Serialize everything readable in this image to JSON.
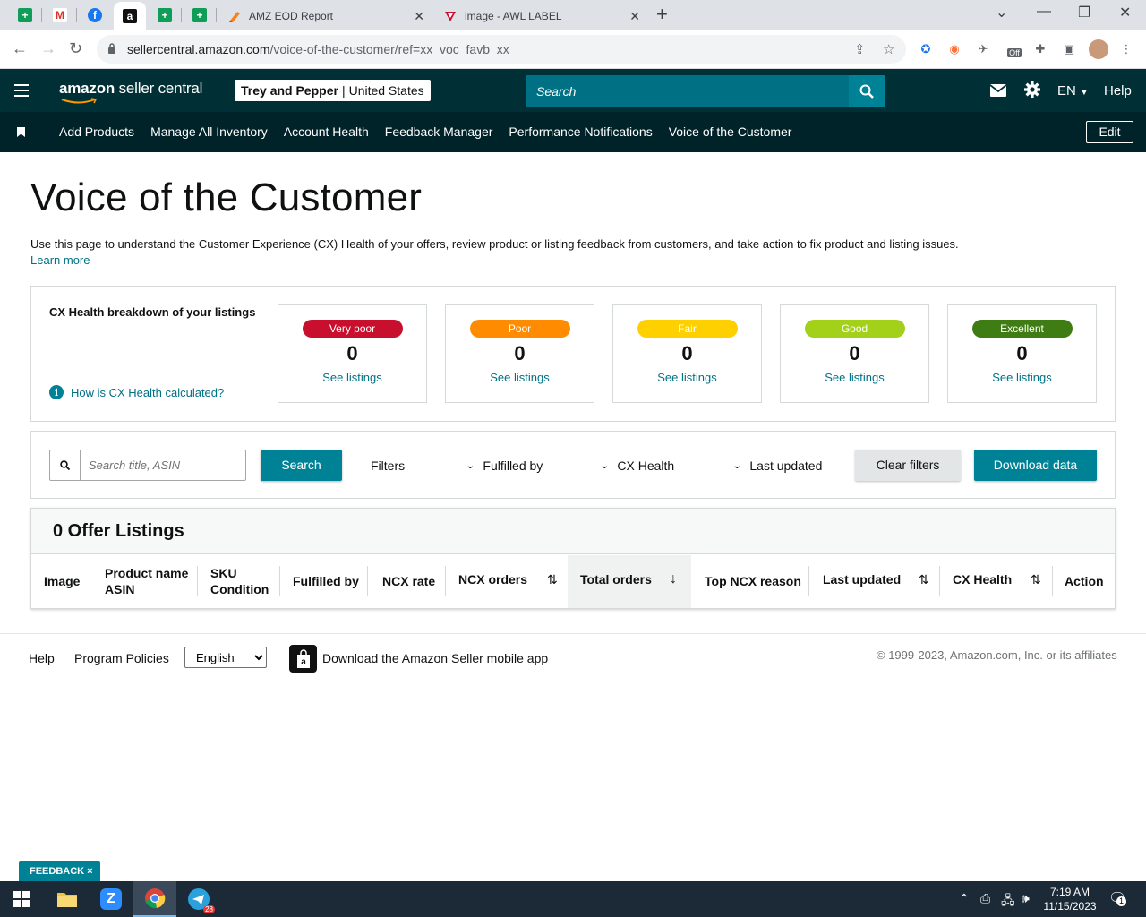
{
  "browser": {
    "tabs": [
      {
        "title": "AMZ EOD Report"
      },
      {
        "title": "image - AWL LABEL"
      }
    ],
    "url_host": "sellercentral.amazon.com",
    "url_path": "/voice-of-the-customer/ref=xx_voc_favb_xx",
    "ext_off_badge": "Off"
  },
  "header": {
    "logo_brand": "amazon",
    "logo_product": " seller central",
    "store_name": "Trey and Pepper",
    "store_region": "United States",
    "search_placeholder": "Search",
    "language": "EN",
    "help": "Help"
  },
  "nav": {
    "items": [
      "Add Products",
      "Manage All Inventory",
      "Account Health",
      "Feedback Manager",
      "Performance Notifications",
      "Voice of the Customer"
    ],
    "edit": "Edit"
  },
  "page": {
    "title": "Voice of the Customer",
    "intro": "Use this page to understand the Customer Experience (CX) Health of your offers, review product or listing feedback from customers, and take action to fix product and listing issues.",
    "learn_more": "Learn more"
  },
  "cx_health": {
    "title": "CX Health breakdown of your listings",
    "how_link": "How is CX Health calculated?",
    "info_glyph": "i",
    "see_listings": "See listings",
    "cards": [
      {
        "label": "Very poor",
        "count": "0",
        "color": "#c8102e",
        "text_color": "#ffffff"
      },
      {
        "label": "Poor",
        "count": "0",
        "color": "#ff8c00",
        "text_color": "#ffffff"
      },
      {
        "label": "Fair",
        "count": "0",
        "color": "#ffd000",
        "text_color": "#ffffff"
      },
      {
        "label": "Good",
        "count": "0",
        "color": "#a3d11a",
        "text_color": "#ffffff"
      },
      {
        "label": "Excellent",
        "count": "0",
        "color": "#3f7d14",
        "text_color": "#ffffff"
      }
    ]
  },
  "filters": {
    "search_placeholder": "Search title, ASIN",
    "search_button": "Search",
    "filters_label": "Filters",
    "fulfilled_by": "Fulfilled by",
    "cx_health": "CX Health",
    "last_updated": "Last updated",
    "clear": "Clear filters",
    "download": "Download data"
  },
  "table": {
    "title": "0 Offer Listings",
    "columns": {
      "image": "Image",
      "product_name": "Product name",
      "asin": "ASIN",
      "sku": "SKU",
      "condition": "Condition",
      "fulfilled_by": "Fulfilled by",
      "ncx_rate": "NCX rate",
      "ncx_orders": "NCX orders",
      "total_orders": "Total orders",
      "top_ncx_reason": "Top NCX reason",
      "last_updated": "Last updated",
      "cx_health": "CX Health",
      "action": "Action"
    }
  },
  "footer": {
    "help": "Help",
    "policies": "Program Policies",
    "language": "English",
    "app": "Download the Amazon Seller mobile app",
    "copyright": "© 1999-2023, Amazon.com, Inc. or its affiliates"
  },
  "feedback": "FEEDBACK ×",
  "taskbar": {
    "time": "7:19 AM",
    "date": "11/15/2023",
    "telegram_badge": "28",
    "notif_count": "1"
  }
}
